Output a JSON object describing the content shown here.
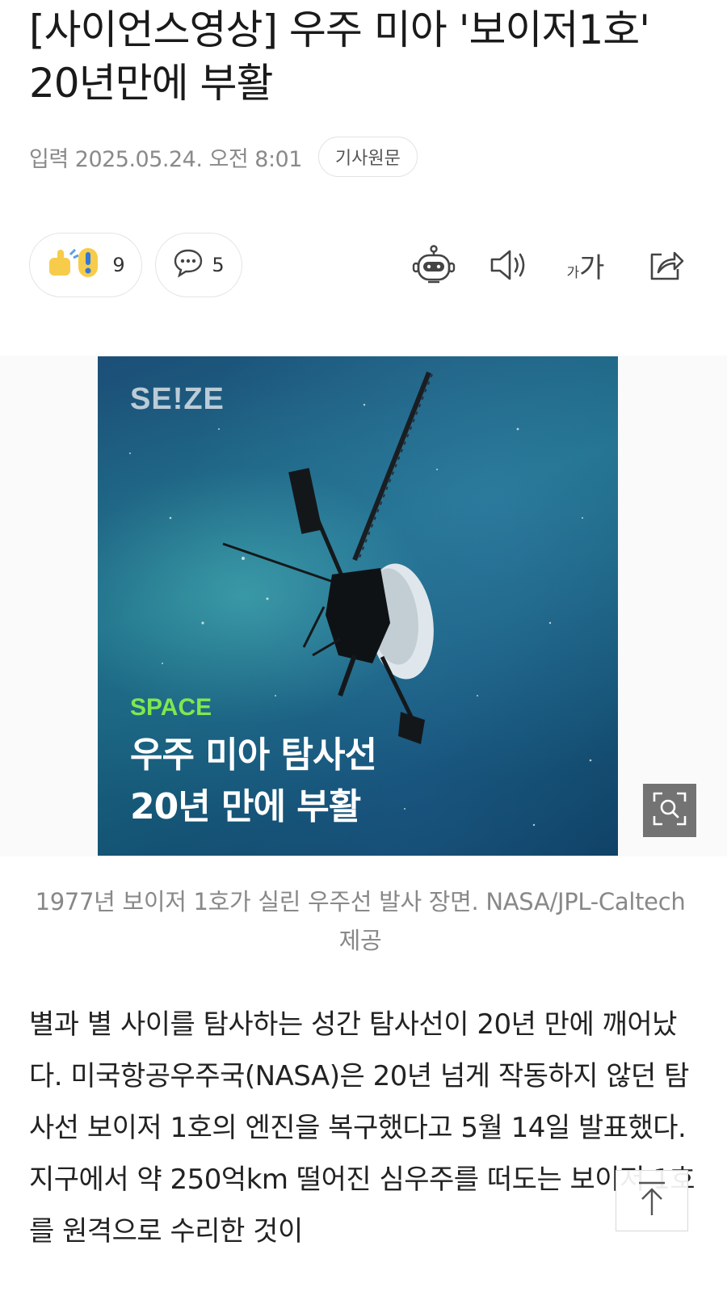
{
  "article": {
    "title": "[사이언스영상] 우주 미아 '보이저1호' 20년만에 부활",
    "date": "입력 2025.05.24. 오전 8:01",
    "source_button": "기사원문"
  },
  "actions": {
    "reaction_count": "9",
    "comment_count": "5",
    "font_small": "가",
    "font_large": "가"
  },
  "photo": {
    "brand": "SE!ZE",
    "tag": "SPACE",
    "headline_line1": "우주 미아 탐사선",
    "headline_line2": "20년 만에 부활",
    "caption": "1977년 보이저 1호가 실린 우주선 발사 장면. NASA/JPL-Caltech 제공"
  },
  "body": {
    "paragraph": "별과 별 사이를 탐사하는 성간 탐사선이 20년 만에 깨어났다. 미국항공우주국(NASA)은 20년 넘게 작동하지 않던 탐사선 보이저 1호의 엔진을 복구했다고 5월 14일 발표했다. 지구에서 약 250억km 떨어진 심우주를 떠도는 보이저 1호를 원격으로 수리한 것이"
  },
  "colors": {
    "tag_green": "#7fe84f",
    "meta_gray": "#8a8a8a"
  },
  "icons": [
    "reaction-icon",
    "comment-icon",
    "ai-summary-icon",
    "speaker-icon",
    "font-size-icon",
    "share-icon",
    "zoom-icon",
    "scroll-top-icon"
  ]
}
